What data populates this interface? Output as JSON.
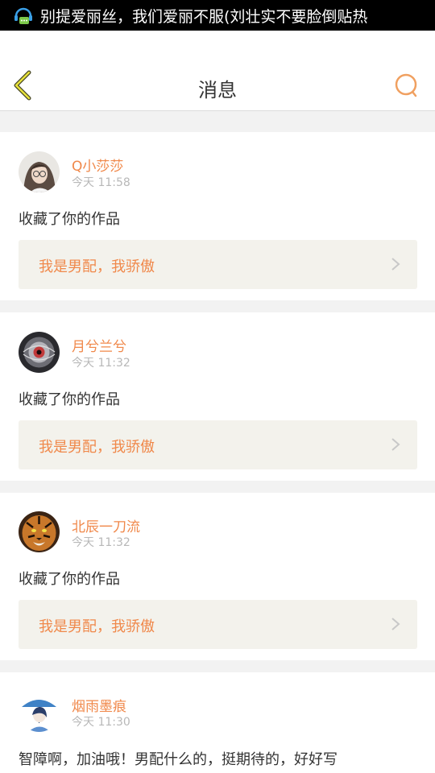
{
  "status_bar": {
    "ticker": "别提爱丽丝，我们爱丽不服(刘壮实不要脸倒贴热"
  },
  "header": {
    "title": "消息"
  },
  "colors": {
    "accent": "#f0884a",
    "quote_bg": "#f3f2ec",
    "divider": "#f2f2f2"
  },
  "messages": [
    {
      "name": "Q小莎莎",
      "time": "今天 11:58",
      "text": "收藏了你的作品",
      "quote": "我是男配，我骄傲"
    },
    {
      "name": "月兮兰兮",
      "time": "今天 11:32",
      "text": "收藏了你的作品",
      "quote": "我是男配，我骄傲"
    },
    {
      "name": "北辰一刀流",
      "time": "今天 11:32",
      "text": "收藏了你的作品",
      "quote": "我是男配，我骄傲"
    },
    {
      "name": "烟雨墨痕",
      "time": "今天 11:30",
      "text": "智障啊，加油哦！男配什么的，挺期待的，好好写"
    }
  ]
}
